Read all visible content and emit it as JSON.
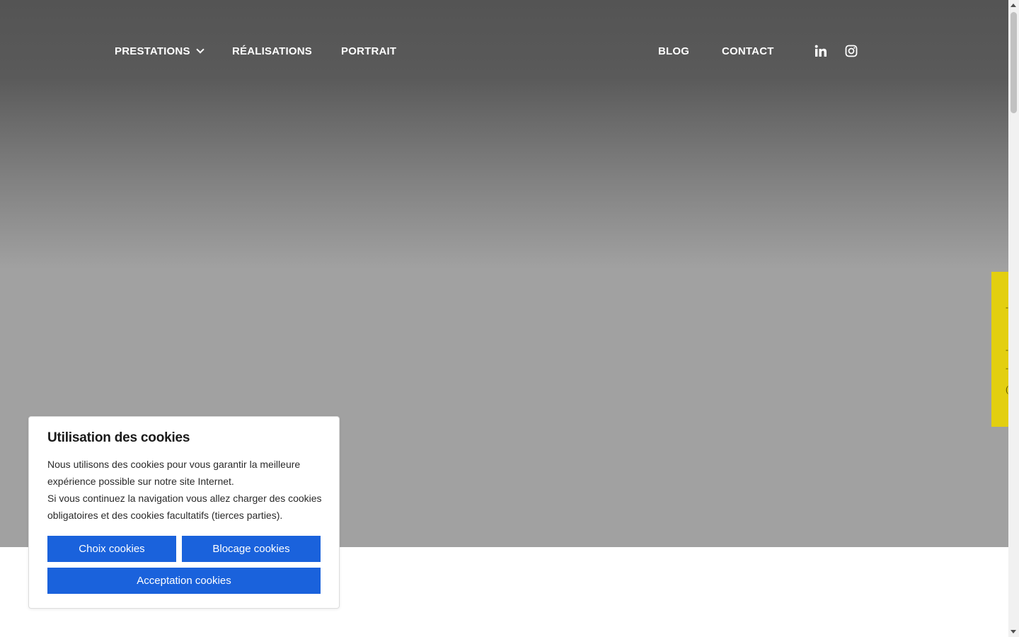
{
  "nav": {
    "left_items": [
      {
        "label": "PRESTATIONS",
        "has_dropdown": true
      },
      {
        "label": "RÉALISATIONS"
      },
      {
        "label": "PORTRAIT"
      }
    ],
    "right_items": [
      {
        "label": "BLOG"
      },
      {
        "label": "CONTACT"
      }
    ],
    "social_icons": [
      "linkedin-icon",
      "instagram-icon"
    ]
  },
  "side_tab": {
    "color": "#e3cf10"
  },
  "cookie_banner": {
    "title": "Utilisation des cookies",
    "text_line1": "Nous utilisons des cookies pour vous garantir la meilleure expérience possible sur notre site Internet.",
    "text_line2": "Si vous continuez la navigation vous allez charger des cookies obligatoires et des cookies facultatifs (tierces parties).",
    "buttons": {
      "choix": "Choix cookies",
      "blocage": "Blocage cookies",
      "acceptation": "Acceptation cookies"
    },
    "button_color": "#1a62dc"
  }
}
